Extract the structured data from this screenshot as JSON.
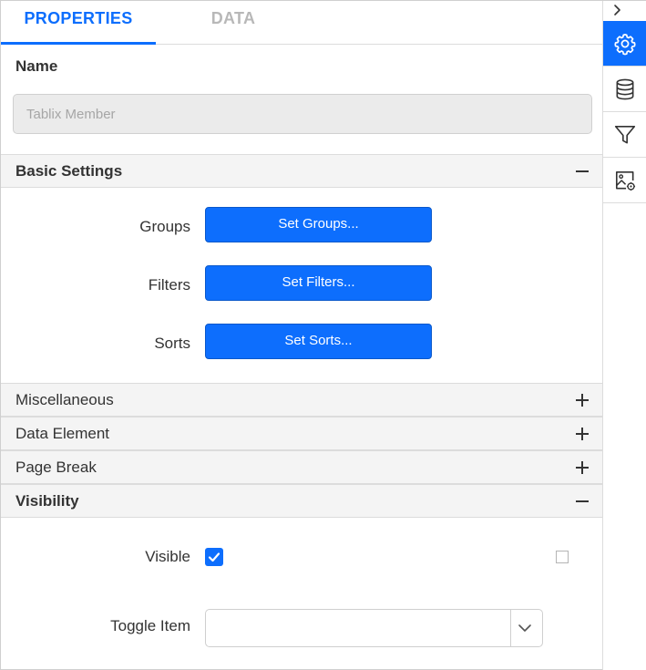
{
  "tabs": [
    {
      "label": "PROPERTIES",
      "active": true
    },
    {
      "label": "DATA",
      "active": false
    }
  ],
  "name": {
    "label": "Name",
    "placeholder": "Tablix Member",
    "value": ""
  },
  "sections": {
    "basic_settings": {
      "title": "Basic Settings",
      "expanded": true
    },
    "miscellaneous": {
      "title": "Miscellaneous",
      "expanded": false
    },
    "data_element": {
      "title": "Data Element",
      "expanded": false
    },
    "page_break": {
      "title": "Page Break",
      "expanded": false
    },
    "visibility": {
      "title": "Visibility",
      "expanded": true
    }
  },
  "basic_settings": {
    "groups": {
      "label": "Groups",
      "button": "Set Groups..."
    },
    "filters": {
      "label": "Filters",
      "button": "Set Filters..."
    },
    "sorts": {
      "label": "Sorts",
      "button": "Set Sorts..."
    }
  },
  "visibility": {
    "visible": {
      "label": "Visible",
      "checked": true,
      "expression_checked": false
    },
    "toggle_item": {
      "label": "Toggle Item",
      "value": ""
    }
  },
  "sidebar": {
    "items": [
      {
        "icon": "gear-icon",
        "active": true
      },
      {
        "icon": "database-icon",
        "active": false
      },
      {
        "icon": "filter-icon",
        "active": false
      },
      {
        "icon": "image-settings-icon",
        "active": false
      }
    ]
  },
  "colors": {
    "accent": "#0d6efd",
    "section_background": "#f4f4f4",
    "input_disabled_background": "#ebebeb"
  }
}
